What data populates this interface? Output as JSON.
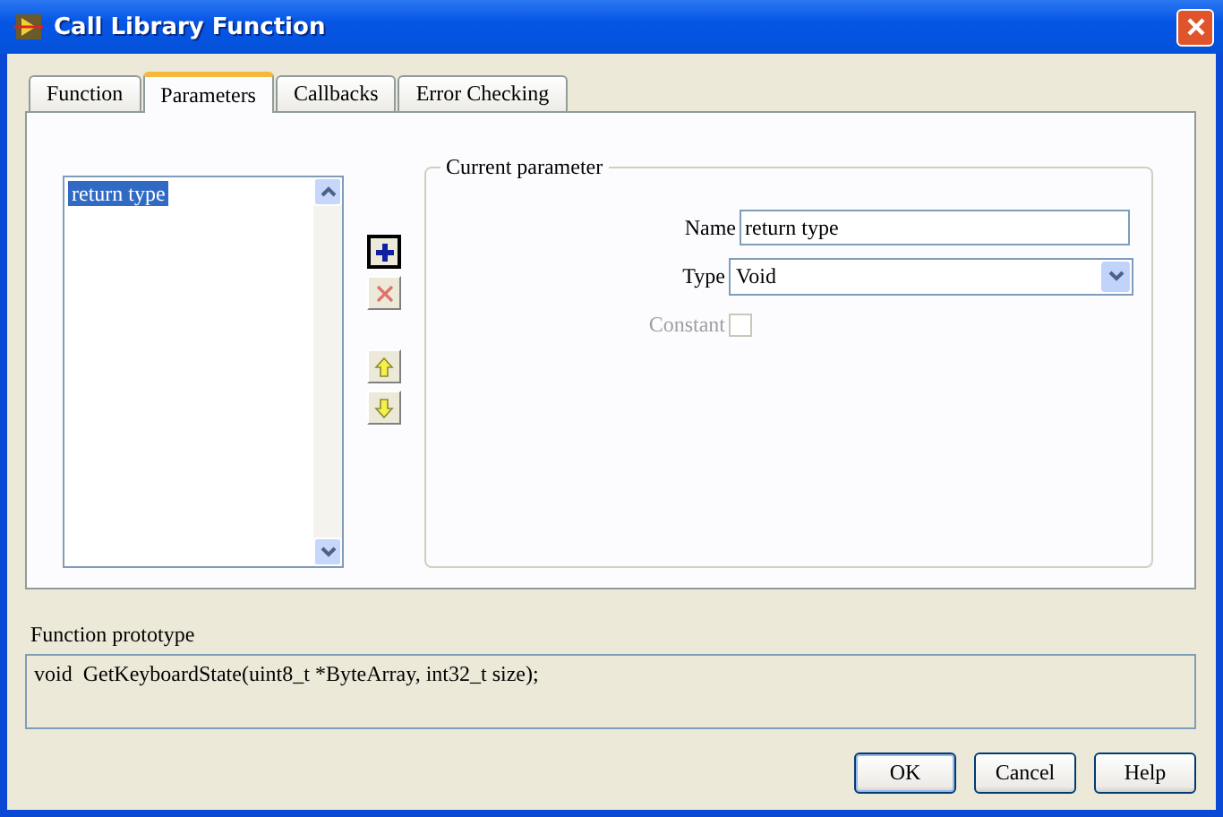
{
  "window": {
    "title": "Call Library Function"
  },
  "tabs": [
    {
      "label": "Function",
      "selected": false
    },
    {
      "label": "Parameters",
      "selected": true
    },
    {
      "label": "Callbacks",
      "selected": false
    },
    {
      "label": "Error Checking",
      "selected": false
    }
  ],
  "parameter_list": {
    "items": [
      {
        "label": "return type",
        "selected": true
      }
    ]
  },
  "list_buttons": [
    {
      "kind": "add",
      "disabled": false
    },
    {
      "kind": "remove",
      "disabled": true
    },
    {
      "kind": "up",
      "disabled": false
    },
    {
      "kind": "down",
      "disabled": false
    }
  ],
  "current_parameter": {
    "title": "Current parameter",
    "name": {
      "label": "Name",
      "value": "return type"
    },
    "type": {
      "label": "Type",
      "value": "Void"
    },
    "constant": {
      "label": "Constant",
      "checked": false,
      "disabled": true
    }
  },
  "prototype": {
    "label": "Function prototype",
    "value": "void  GetKeyboardState(uint8_t *ByteArray, int32_t size);"
  },
  "buttons": [
    {
      "label": "OK",
      "default": true
    },
    {
      "label": "Cancel",
      "default": false
    },
    {
      "label": "Help",
      "default": false
    }
  ]
}
